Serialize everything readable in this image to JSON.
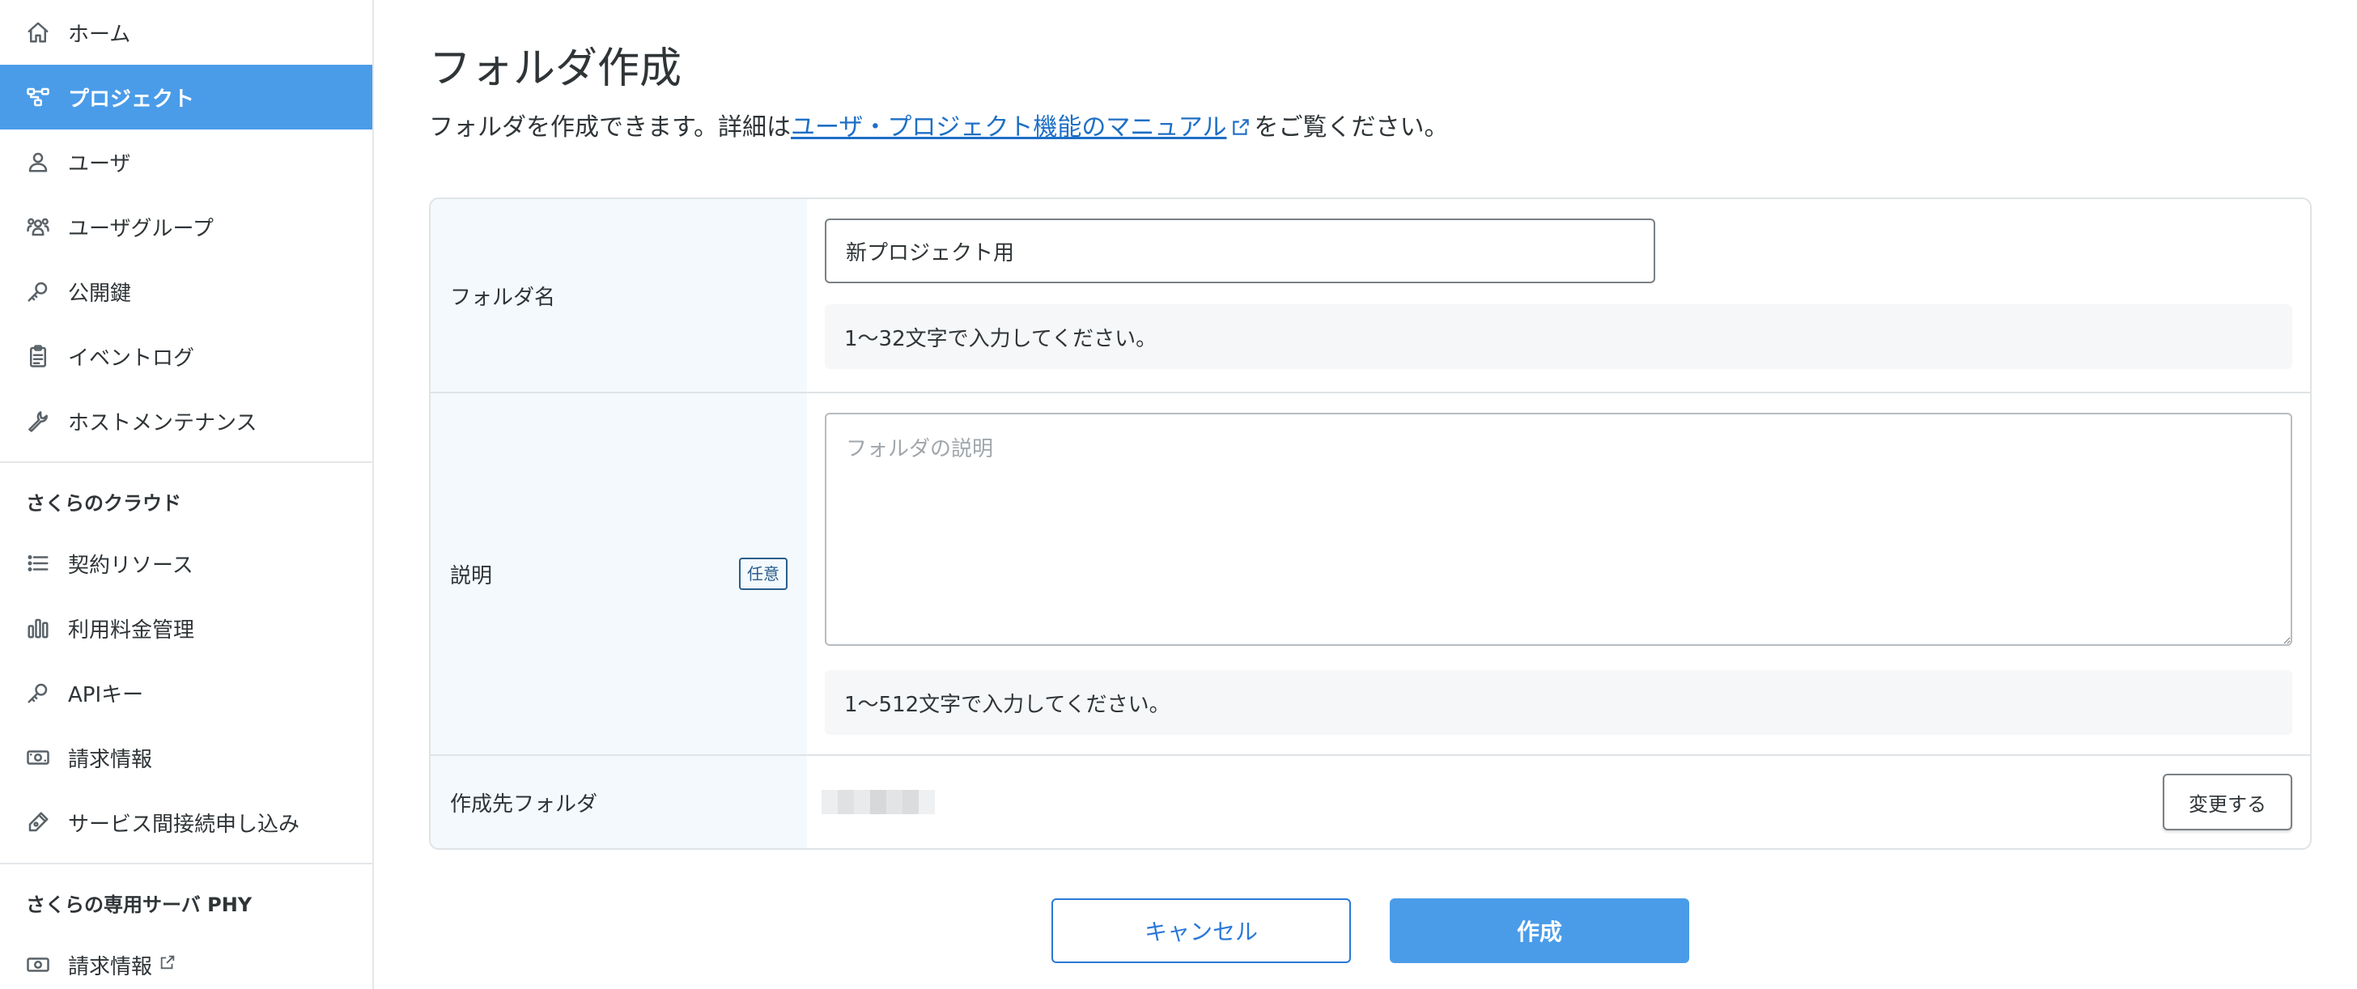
{
  "sidebar": {
    "items": [
      {
        "label": "ホーム",
        "icon": "home-icon"
      },
      {
        "label": "プロジェクト",
        "icon": "project-icon",
        "active": true
      },
      {
        "label": "ユーザ",
        "icon": "user-icon"
      },
      {
        "label": "ユーザグループ",
        "icon": "user-group-icon"
      },
      {
        "label": "公開鍵",
        "icon": "key-icon"
      },
      {
        "label": "イベントログ",
        "icon": "clipboard-icon"
      },
      {
        "label": "ホストメンテナンス",
        "icon": "wrench-icon"
      }
    ],
    "section1": {
      "heading": "さくらのクラウド",
      "items": [
        {
          "label": "契約リソース",
          "icon": "list-icon"
        },
        {
          "label": "利用料金管理",
          "icon": "bar-chart-icon"
        },
        {
          "label": "APIキー",
          "icon": "key-icon"
        },
        {
          "label": "請求情報",
          "icon": "money-icon"
        },
        {
          "label": "サービス間接続申し込み",
          "icon": "pen-icon"
        }
      ]
    },
    "section2": {
      "heading": "さくらの専用サーバ PHY",
      "items": [
        {
          "label": "請求情報",
          "icon": "money-icon",
          "external": true
        }
      ]
    }
  },
  "page": {
    "title": "フォルダ作成",
    "desc_prefix": "フォルダを作成できます。詳細は",
    "desc_link": "ユーザ・プロジェクト機能のマニュアル",
    "desc_suffix": "をご覧ください。"
  },
  "form": {
    "folder_name": {
      "label": "フォルダ名",
      "value": "新プロジェクト用",
      "hint": "1〜32文字で入力してください。"
    },
    "description": {
      "label": "説明",
      "badge": "任意",
      "placeholder": "フォルダの説明",
      "hint": "1〜512文字で入力してください。"
    },
    "destination": {
      "label": "作成先フォルダ",
      "change_label": "変更する"
    }
  },
  "actions": {
    "cancel_label": "キャンセル",
    "create_label": "作成"
  },
  "colors": {
    "accent": "#4a9ce9",
    "link": "#1e6fc5",
    "label_bg": "#f3f9fc"
  }
}
